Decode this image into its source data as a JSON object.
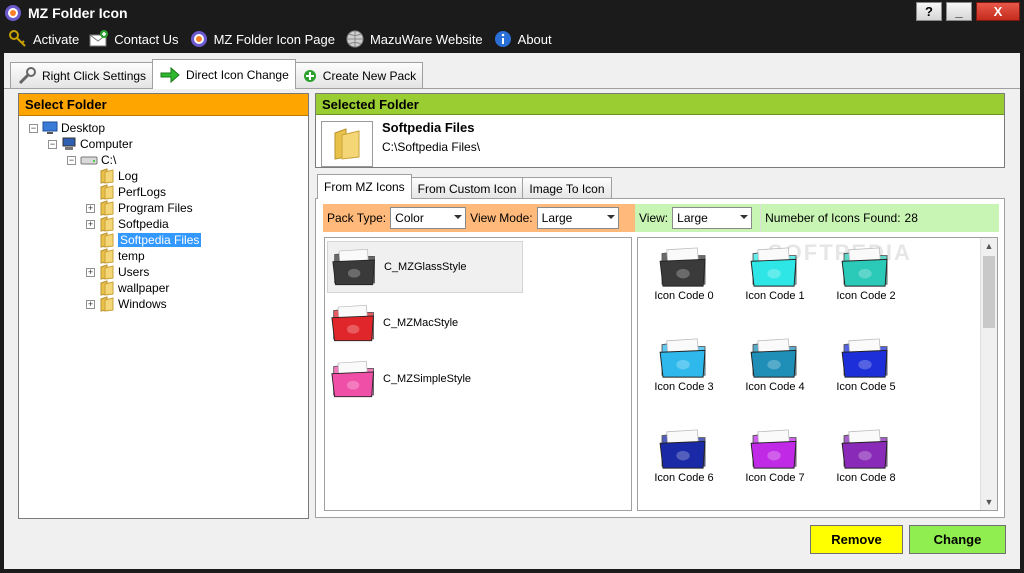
{
  "window": {
    "title": "MZ Folder Icon",
    "help_label": "?",
    "minimize_label": "_",
    "close_label": "X"
  },
  "menu": {
    "items": [
      {
        "label": "Activate",
        "icon": "keys-icon"
      },
      {
        "label": "Contact Us",
        "icon": "mail-add-icon"
      },
      {
        "label": "MZ Folder Icon Page",
        "icon": "app-logo-icon"
      },
      {
        "label": "MazuWare Website",
        "icon": "globe-icon"
      },
      {
        "label": "About",
        "icon": "info-icon"
      }
    ]
  },
  "tabs": [
    {
      "label": "Right Click Settings",
      "icon": "wrench-icon",
      "active": false
    },
    {
      "label": "Direct Icon Change",
      "icon": "green-arrow-icon",
      "active": true
    },
    {
      "label": "Create New Pack",
      "icon": "add-icon",
      "active": false
    }
  ],
  "select_folder": {
    "header": "Select Folder",
    "tree": [
      {
        "label": "Desktop",
        "level": 0,
        "expander": "−",
        "icon": "desktop-icon"
      },
      {
        "label": "Computer",
        "level": 1,
        "expander": "−",
        "icon": "computer-icon"
      },
      {
        "label": "C:\\",
        "level": 2,
        "expander": "−",
        "icon": "drive-icon"
      },
      {
        "label": "Log",
        "level": 3,
        "expander": "",
        "icon": "folder-icon"
      },
      {
        "label": "PerfLogs",
        "level": 3,
        "expander": "",
        "icon": "folder-icon"
      },
      {
        "label": "Program Files",
        "level": 3,
        "expander": "+",
        "icon": "folder-icon"
      },
      {
        "label": "Softpedia",
        "level": 3,
        "expander": "+",
        "icon": "folder-icon"
      },
      {
        "label": "Softpedia Files",
        "level": 3,
        "expander": "",
        "icon": "folder-icon",
        "selected": true
      },
      {
        "label": "temp",
        "level": 3,
        "expander": "",
        "icon": "folder-icon"
      },
      {
        "label": "Users",
        "level": 3,
        "expander": "+",
        "icon": "folder-icon"
      },
      {
        "label": "wallpaper",
        "level": 3,
        "expander": "",
        "icon": "folder-icon"
      },
      {
        "label": "Windows",
        "level": 3,
        "expander": "+",
        "icon": "folder-icon"
      }
    ]
  },
  "selected_folder": {
    "header": "Selected Folder",
    "name": "Softpedia Files",
    "path": "C:\\Softpedia Files\\"
  },
  "sub_tabs": [
    {
      "label": "From MZ Icons",
      "active": true
    },
    {
      "label": "From Custom Icon",
      "active": false
    },
    {
      "label": "Image To Icon",
      "active": false
    }
  ],
  "options": {
    "pack_type_label": "Pack Type:",
    "pack_type_value": "Color",
    "view_mode_label": "View Mode:",
    "view_mode_value": "Large",
    "view_label": "View:",
    "view_value": "Large",
    "icons_found_label": "Numeber of Icons Found:",
    "icons_found_value": "28"
  },
  "styles": [
    {
      "label": "C_MZGlassStyle",
      "color": "#3a3a3a",
      "highlight": true
    },
    {
      "label": "C_MZMacStyle",
      "color": "#e0262b",
      "highlight": false
    },
    {
      "label": "C_MZSimpleStyle",
      "color": "#f04fa8",
      "highlight": false
    }
  ],
  "icons": [
    {
      "label": "Icon Code 0",
      "color": "#3a3a3a"
    },
    {
      "label": "Icon Code 1",
      "color": "#2ee6e6"
    },
    {
      "label": "Icon Code 2",
      "color": "#2bc9b8"
    },
    {
      "label": "Icon Code 3",
      "color": "#2fb8ec"
    },
    {
      "label": "Icon Code 4",
      "color": "#1f8fb8"
    },
    {
      "label": "Icon Code 5",
      "color": "#1c2fd8"
    },
    {
      "label": "Icon Code 6",
      "color": "#1a2aa6"
    },
    {
      "label": "Icon Code 7",
      "color": "#c02ae6"
    },
    {
      "label": "Icon Code 8",
      "color": "#8a2ab8"
    }
  ],
  "watermark": "SOFTPEDIA",
  "buttons": {
    "remove": "Remove",
    "change": "Change"
  }
}
